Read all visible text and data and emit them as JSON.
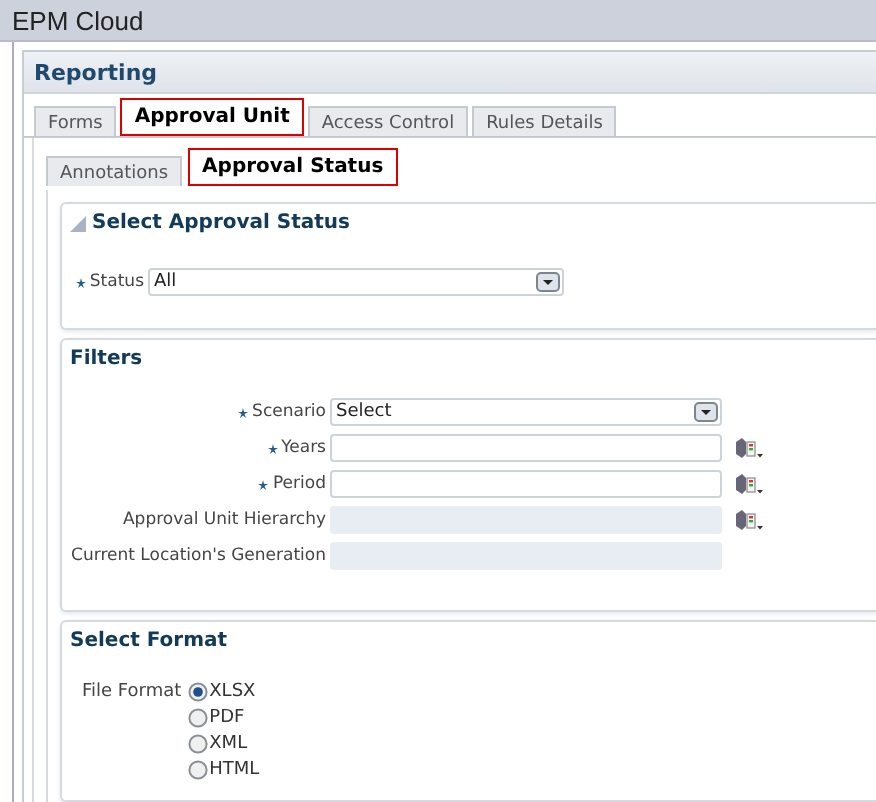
{
  "window": {
    "title": "EPM Cloud"
  },
  "panel": {
    "title": "Reporting"
  },
  "tabs": [
    {
      "label": "Forms",
      "selected": false
    },
    {
      "label": "Approval Unit",
      "selected": true
    },
    {
      "label": "Access Control",
      "selected": false
    },
    {
      "label": "Rules Details",
      "selected": false
    }
  ],
  "subtabs": [
    {
      "label": "Annotations",
      "selected": false
    },
    {
      "label": "Approval Status",
      "selected": true
    }
  ],
  "status_section": {
    "title": "Select Approval Status",
    "expanded": true,
    "field": {
      "label": "Status",
      "required": true,
      "kind": "select",
      "value": "All"
    }
  },
  "filters": {
    "title": "Filters",
    "fields": [
      {
        "label": "Scenario",
        "required": true,
        "kind": "select",
        "value": "Select",
        "disabled": false,
        "picker": false
      },
      {
        "label": "Years",
        "required": true,
        "kind": "text",
        "disabled": false,
        "picker": true
      },
      {
        "label": "Period",
        "required": true,
        "kind": "text",
        "disabled": false,
        "picker": true
      },
      {
        "label": "Approval Unit Hierarchy",
        "required": false,
        "kind": "text",
        "disabled": true,
        "picker": true
      },
      {
        "label": "Current Location's Generation",
        "required": false,
        "kind": "text",
        "disabled": true,
        "picker": false
      }
    ]
  },
  "format": {
    "title": "Select Format",
    "label": "File Format",
    "options": [
      {
        "label": "XLSX",
        "selected": true
      },
      {
        "label": "PDF",
        "selected": false
      },
      {
        "label": "XML",
        "selected": false
      },
      {
        "label": "HTML",
        "selected": false
      }
    ]
  }
}
